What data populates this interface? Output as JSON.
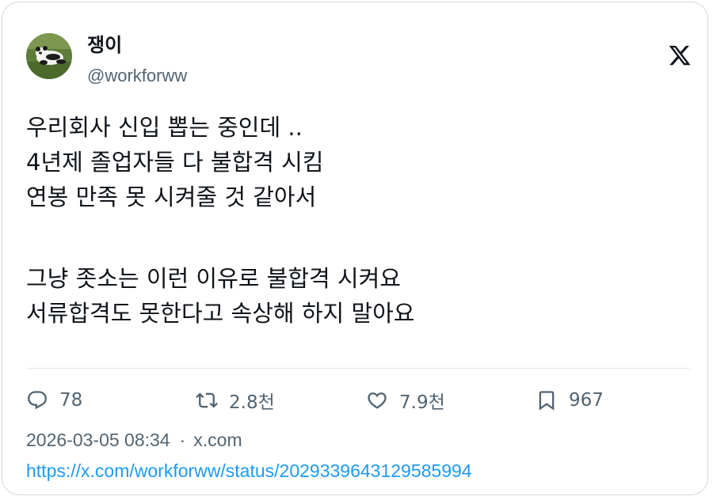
{
  "author": {
    "display_name": "쟁이",
    "handle": "@workforww",
    "avatar_icon": "panda-avatar-icon"
  },
  "platform": {
    "logo_icon": "x-logo-icon"
  },
  "tweet": {
    "lines": [
      "우리회사 신입 뽑는 중인데 ..",
      "4년제 졸업자들 다 불합격 시킴",
      "연봉 만족 못 시켜줄 것 같아서",
      "",
      "그냥 좃소는 이런 이유로 불합격 시켜요",
      "서류합격도 못한다고 속상해 하지 말아요"
    ]
  },
  "actions": {
    "replies": "78",
    "retweets": "2.8천",
    "likes": "7.9천",
    "bookmarks": "967"
  },
  "meta": {
    "timestamp": "2026-03-05 08:34",
    "separator": "·",
    "source": "x.com",
    "url": "https://x.com/workforww/status/2029339643129585994"
  },
  "colors": {
    "text": "#0f1419",
    "secondary": "#536471",
    "link": "#1d9bf0",
    "border": "#cfd9de"
  }
}
